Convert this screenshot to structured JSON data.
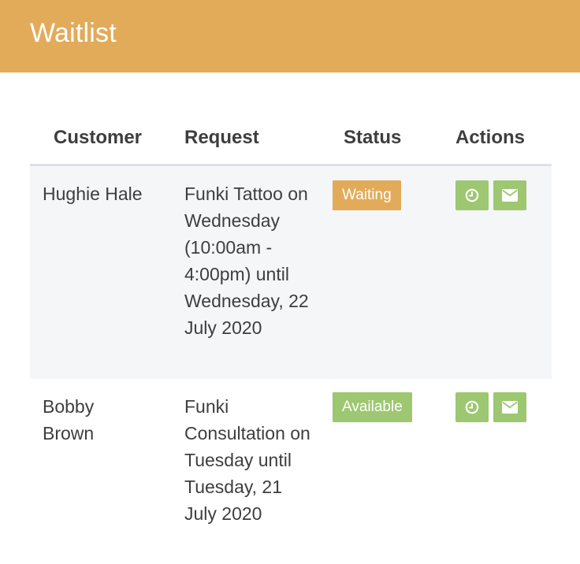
{
  "header": {
    "title": "Waitlist"
  },
  "table": {
    "columns": {
      "customer": "Customer",
      "request": "Request",
      "status": "Status",
      "actions": "Actions"
    },
    "rows": [
      {
        "customer": "Hughie Hale",
        "request": "Funki Tattoo on Wednesday (10:00am - 4:00pm) until Wednesday, 22 July 2020",
        "status": "Waiting",
        "actions": [
          "clock-icon",
          "envelope-icon"
        ]
      },
      {
        "customer": "Bobby Brown",
        "request": "Funki Consultation on Tuesday until Tuesday, 21 July 2020",
        "status": "Available",
        "actions": [
          "clock-icon",
          "envelope-icon"
        ]
      }
    ]
  },
  "colors": {
    "header": "#e2ab59",
    "waiting": "#e2ab59",
    "available": "#9dc770",
    "action_button": "#9dc770"
  }
}
